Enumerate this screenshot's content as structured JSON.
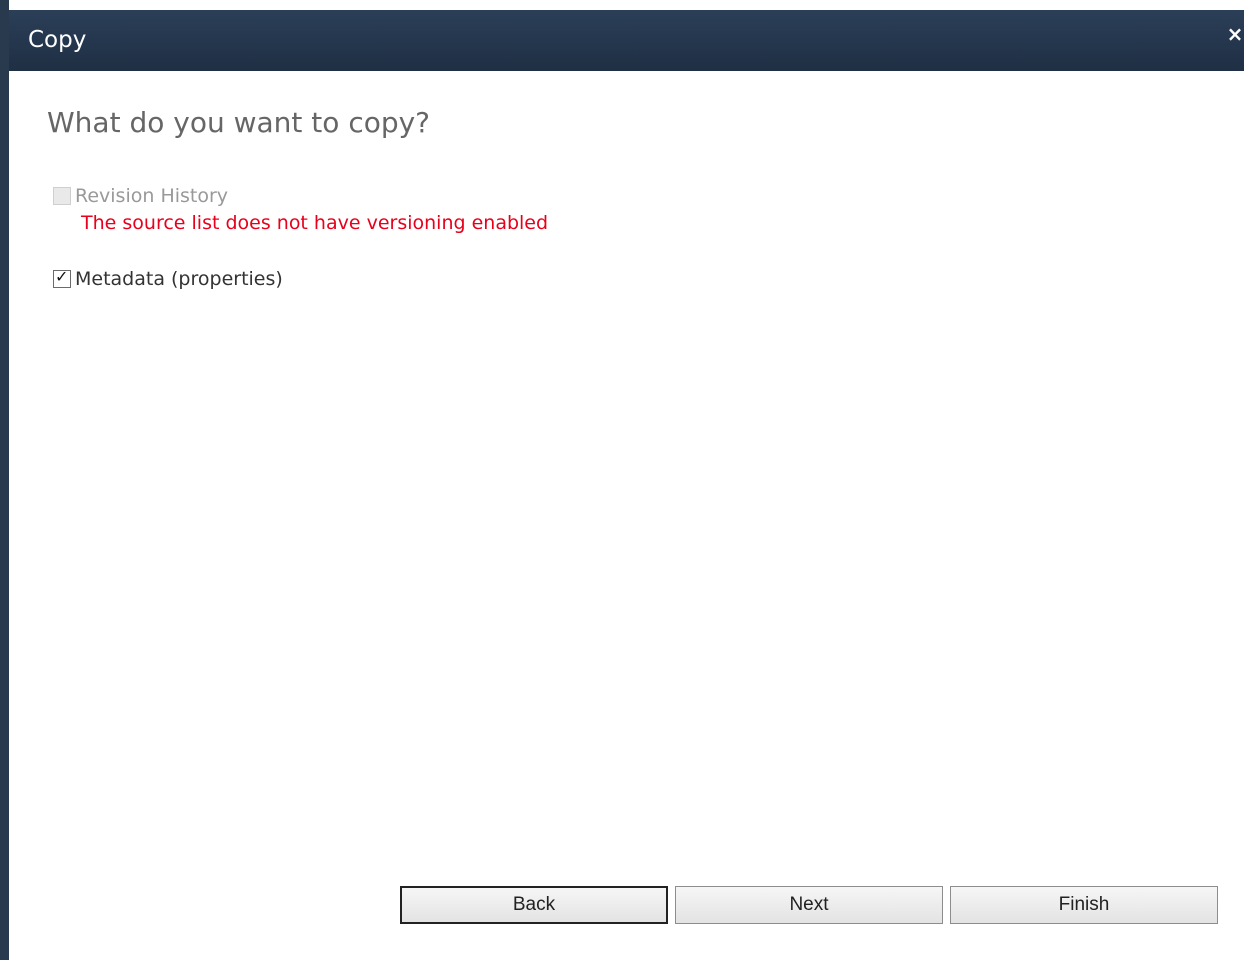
{
  "dialog": {
    "title": "Copy",
    "close_glyph": "×",
    "close_icon": "close-icon"
  },
  "main": {
    "heading": "What do you want to copy?",
    "options": [
      {
        "label": "Revision History",
        "checked": false,
        "disabled": true,
        "error": "The source list does not have versioning enabled"
      },
      {
        "label": "Metadata (properties)",
        "checked": true,
        "disabled": false,
        "checkmark": "✓"
      }
    ]
  },
  "footer": {
    "back_label": "Back",
    "next_label": "Next",
    "finish_label": "Finish"
  },
  "colors": {
    "titlebar": "#1f2f44",
    "error": "#e8001c"
  }
}
